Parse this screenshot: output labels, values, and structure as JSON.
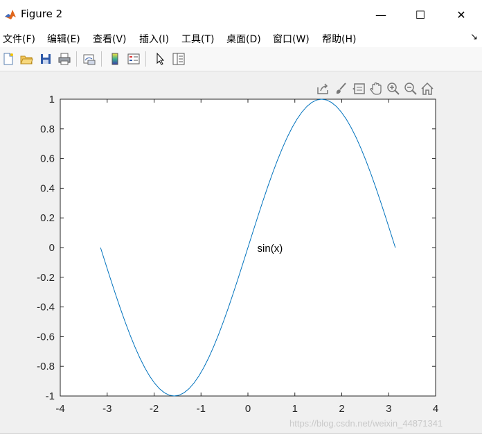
{
  "window": {
    "title": "Figure 2",
    "controls": {
      "minimize": "—",
      "maximize": "☐",
      "close": "✕"
    }
  },
  "menu": {
    "items": [
      {
        "label": "文件(F)"
      },
      {
        "label": "编辑(E)"
      },
      {
        "label": "查看(V)"
      },
      {
        "label": "插入(I)"
      },
      {
        "label": "工具(T)"
      },
      {
        "label": "桌面(D)"
      },
      {
        "label": "窗口(W)"
      },
      {
        "label": "帮助(H)"
      }
    ],
    "dock_glyph": "↘"
  },
  "toolbar": {
    "icons": [
      "new-figure-icon",
      "open-file-icon",
      "save-icon",
      "print-icon",
      "link-plot-icon",
      "colorbar-icon",
      "legend-icon",
      "edit-plot-icon",
      "property-inspector-icon"
    ]
  },
  "axes_toolbar": {
    "icons": [
      "export-icon",
      "brush-icon",
      "data-tips-icon",
      "pan-icon",
      "zoom-in-icon",
      "zoom-out-icon",
      "home-icon"
    ]
  },
  "chart_data": {
    "type": "line",
    "title": "",
    "xlabel": "",
    "ylabel": "",
    "xlim": [
      -4,
      4
    ],
    "ylim": [
      -1,
      1
    ],
    "xticks": [
      "-4",
      "-3",
      "-2",
      "-1",
      "0",
      "1",
      "2",
      "3",
      "4"
    ],
    "yticks": [
      "-1",
      "-0.8",
      "-0.6",
      "-0.4",
      "-0.2",
      "0",
      "0.2",
      "0.4",
      "0.6",
      "0.8",
      "1"
    ],
    "grid": false,
    "series": [
      {
        "color": "#0072bd",
        "function": "sin(x)",
        "x_range": [
          -3.1416,
          3.1416
        ],
        "points": 60
      }
    ],
    "annotations": [
      {
        "text": "sin(x)",
        "x": 0.2,
        "y": 0
      }
    ]
  },
  "watermark": "https://blog.csdn.net/weixin_44871341"
}
